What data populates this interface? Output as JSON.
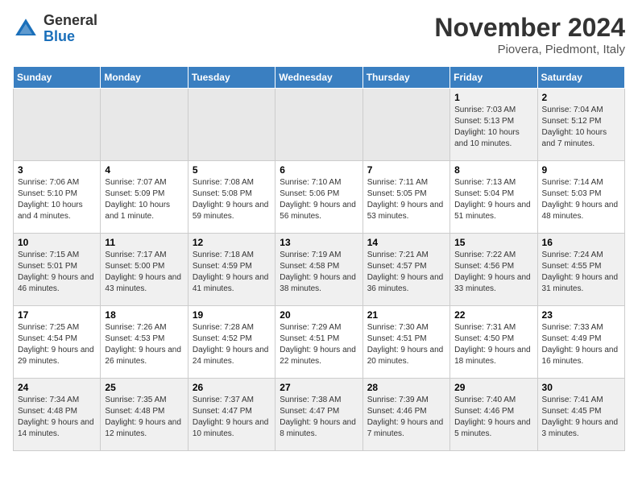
{
  "header": {
    "logo_line1": "General",
    "logo_line2": "Blue",
    "month_title": "November 2024",
    "location": "Piovera, Piedmont, Italy"
  },
  "weekdays": [
    "Sunday",
    "Monday",
    "Tuesday",
    "Wednesday",
    "Thursday",
    "Friday",
    "Saturday"
  ],
  "weeks": [
    [
      {
        "day": "",
        "info": ""
      },
      {
        "day": "",
        "info": ""
      },
      {
        "day": "",
        "info": ""
      },
      {
        "day": "",
        "info": ""
      },
      {
        "day": "",
        "info": ""
      },
      {
        "day": "1",
        "info": "Sunrise: 7:03 AM\nSunset: 5:13 PM\nDaylight: 10 hours and 10 minutes."
      },
      {
        "day": "2",
        "info": "Sunrise: 7:04 AM\nSunset: 5:12 PM\nDaylight: 10 hours and 7 minutes."
      }
    ],
    [
      {
        "day": "3",
        "info": "Sunrise: 7:06 AM\nSunset: 5:10 PM\nDaylight: 10 hours and 4 minutes."
      },
      {
        "day": "4",
        "info": "Sunrise: 7:07 AM\nSunset: 5:09 PM\nDaylight: 10 hours and 1 minute."
      },
      {
        "day": "5",
        "info": "Sunrise: 7:08 AM\nSunset: 5:08 PM\nDaylight: 9 hours and 59 minutes."
      },
      {
        "day": "6",
        "info": "Sunrise: 7:10 AM\nSunset: 5:06 PM\nDaylight: 9 hours and 56 minutes."
      },
      {
        "day": "7",
        "info": "Sunrise: 7:11 AM\nSunset: 5:05 PM\nDaylight: 9 hours and 53 minutes."
      },
      {
        "day": "8",
        "info": "Sunrise: 7:13 AM\nSunset: 5:04 PM\nDaylight: 9 hours and 51 minutes."
      },
      {
        "day": "9",
        "info": "Sunrise: 7:14 AM\nSunset: 5:03 PM\nDaylight: 9 hours and 48 minutes."
      }
    ],
    [
      {
        "day": "10",
        "info": "Sunrise: 7:15 AM\nSunset: 5:01 PM\nDaylight: 9 hours and 46 minutes."
      },
      {
        "day": "11",
        "info": "Sunrise: 7:17 AM\nSunset: 5:00 PM\nDaylight: 9 hours and 43 minutes."
      },
      {
        "day": "12",
        "info": "Sunrise: 7:18 AM\nSunset: 4:59 PM\nDaylight: 9 hours and 41 minutes."
      },
      {
        "day": "13",
        "info": "Sunrise: 7:19 AM\nSunset: 4:58 PM\nDaylight: 9 hours and 38 minutes."
      },
      {
        "day": "14",
        "info": "Sunrise: 7:21 AM\nSunset: 4:57 PM\nDaylight: 9 hours and 36 minutes."
      },
      {
        "day": "15",
        "info": "Sunrise: 7:22 AM\nSunset: 4:56 PM\nDaylight: 9 hours and 33 minutes."
      },
      {
        "day": "16",
        "info": "Sunrise: 7:24 AM\nSunset: 4:55 PM\nDaylight: 9 hours and 31 minutes."
      }
    ],
    [
      {
        "day": "17",
        "info": "Sunrise: 7:25 AM\nSunset: 4:54 PM\nDaylight: 9 hours and 29 minutes."
      },
      {
        "day": "18",
        "info": "Sunrise: 7:26 AM\nSunset: 4:53 PM\nDaylight: 9 hours and 26 minutes."
      },
      {
        "day": "19",
        "info": "Sunrise: 7:28 AM\nSunset: 4:52 PM\nDaylight: 9 hours and 24 minutes."
      },
      {
        "day": "20",
        "info": "Sunrise: 7:29 AM\nSunset: 4:51 PM\nDaylight: 9 hours and 22 minutes."
      },
      {
        "day": "21",
        "info": "Sunrise: 7:30 AM\nSunset: 4:51 PM\nDaylight: 9 hours and 20 minutes."
      },
      {
        "day": "22",
        "info": "Sunrise: 7:31 AM\nSunset: 4:50 PM\nDaylight: 9 hours and 18 minutes."
      },
      {
        "day": "23",
        "info": "Sunrise: 7:33 AM\nSunset: 4:49 PM\nDaylight: 9 hours and 16 minutes."
      }
    ],
    [
      {
        "day": "24",
        "info": "Sunrise: 7:34 AM\nSunset: 4:48 PM\nDaylight: 9 hours and 14 minutes."
      },
      {
        "day": "25",
        "info": "Sunrise: 7:35 AM\nSunset: 4:48 PM\nDaylight: 9 hours and 12 minutes."
      },
      {
        "day": "26",
        "info": "Sunrise: 7:37 AM\nSunset: 4:47 PM\nDaylight: 9 hours and 10 minutes."
      },
      {
        "day": "27",
        "info": "Sunrise: 7:38 AM\nSunset: 4:47 PM\nDaylight: 9 hours and 8 minutes."
      },
      {
        "day": "28",
        "info": "Sunrise: 7:39 AM\nSunset: 4:46 PM\nDaylight: 9 hours and 7 minutes."
      },
      {
        "day": "29",
        "info": "Sunrise: 7:40 AM\nSunset: 4:46 PM\nDaylight: 9 hours and 5 minutes."
      },
      {
        "day": "30",
        "info": "Sunrise: 7:41 AM\nSunset: 4:45 PM\nDaylight: 9 hours and 3 minutes."
      }
    ]
  ]
}
